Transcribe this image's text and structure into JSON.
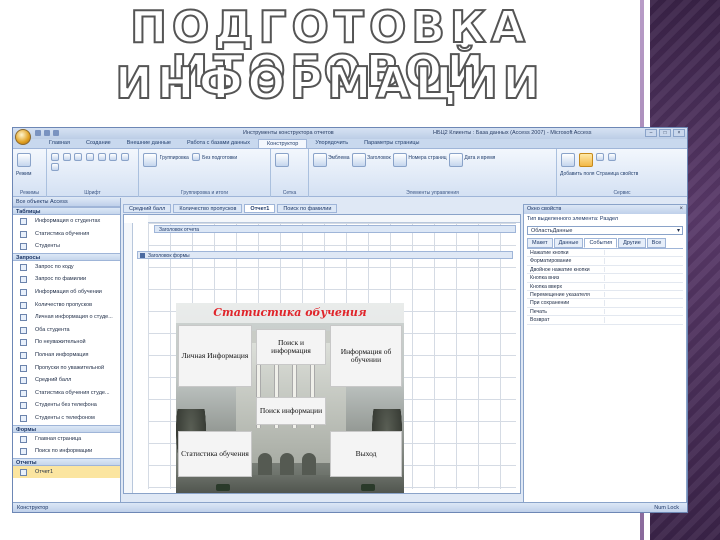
{
  "slide": {
    "title_line1": "ПОДГОТОВКА ИТОГОВОЙ",
    "title_line2": "ИНФОРМАЦИИ"
  },
  "window": {
    "title": "Инструменты конструктора отчетов",
    "title_right": "НБЦ2 Клиенты : База данных (Access 2007) - Microsoft Access"
  },
  "ribbon": {
    "tabs": [
      "Главная",
      "Создание",
      "Внешние данные",
      "Работа с базами данных",
      "Конструктор",
      "Упорядочить",
      "Параметры страницы"
    ],
    "active_tab": "Конструктор",
    "groups": [
      {
        "label": "Режимы",
        "items": [
          "Режим"
        ]
      },
      {
        "label": "Шрифт",
        "items": []
      },
      {
        "label": "Группировка и итоги",
        "items": [
          "Группировка",
          "Без подготовки"
        ]
      },
      {
        "label": "Сетка",
        "items": []
      },
      {
        "label": "Элементы управления",
        "items": [
          "Эмблема",
          "Заголовок",
          "Номера страниц",
          "Дата и время"
        ]
      },
      {
        "label": "Сервис",
        "items": [
          "Добавить поля",
          "Страница свойств"
        ]
      }
    ]
  },
  "nav": {
    "header": "Все объекты Access",
    "groups": [
      {
        "name": "Таблицы",
        "items": [
          "Информация о студентах",
          "Статистика обучения",
          "Студенты"
        ]
      },
      {
        "name": "Запросы",
        "items": [
          "Запрос по коду",
          "Запрос по фамилии",
          "Информация об обучении",
          "Количество пропусков",
          "Личная информация о студе...",
          "Оба студента",
          "По неуважительной",
          "Полная информация",
          "Пропуски по уважительной",
          "Средний балл",
          "Статистика обучения студе...",
          "Студенты без телефона",
          "Студенты с телефоном"
        ]
      },
      {
        "name": "Формы",
        "items": [
          "Главная страница",
          "Поиск по информации"
        ]
      },
      {
        "name": "Отчеты",
        "items": [
          "Отчет1"
        ]
      }
    ]
  },
  "doc_tabs": [
    "Средний балл",
    "Количество пропусков",
    "Отчет1",
    "Поиск по фамилии"
  ],
  "design": {
    "header_section": "Заголовок отчета",
    "section_label": "Заголовок формы"
  },
  "form": {
    "title": "Статистика обучения",
    "buttons": {
      "personal": "Личная Информация",
      "search_info": "Поиск и информация",
      "edu_info": "Информация об обучении",
      "search": "Поиск информации",
      "stats": "Статистика обучения",
      "exit": "Выход"
    }
  },
  "property_sheet": {
    "title": "Окно свойств",
    "subtitle": "Тип выделенного элемента: Раздел",
    "selection": "ОбластьДанные",
    "tabs": [
      "Макет",
      "Данные",
      "События",
      "Другие",
      "Все"
    ],
    "active_tab": "События",
    "rows": [
      "Нажатие кнопки",
      "Форматирование",
      "Двойное нажатие кнопки",
      "Кнопка вниз",
      "Кнопка вверх",
      "Перемещение указателя",
      "При сохранении",
      "Печать",
      "Возврат"
    ]
  },
  "status": {
    "left": "Конструктор",
    "right": "Num Lock"
  }
}
